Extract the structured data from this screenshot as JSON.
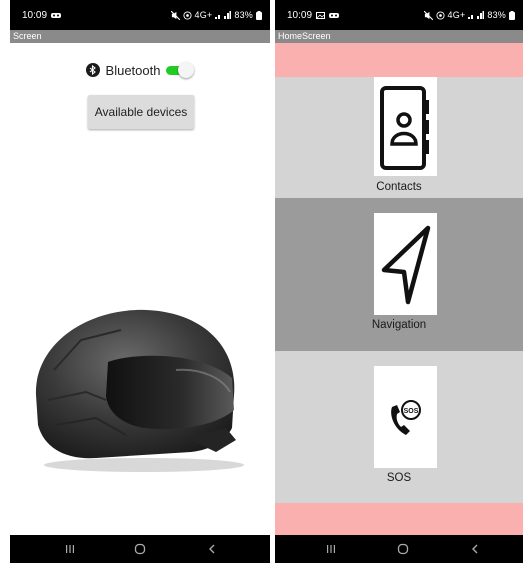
{
  "status_left": {
    "time": "10:09",
    "battery": "83%",
    "network": "4G+"
  },
  "status_right": {
    "time": "10:09",
    "battery": "83%",
    "network": "4G+"
  },
  "screen_left": {
    "title": "Screen",
    "bluetooth_label": "Bluetooth",
    "bluetooth_on": true,
    "available_button": "Available devices"
  },
  "screen_right": {
    "title": "HomeScreen",
    "items": [
      {
        "label": "Contacts",
        "icon": "contacts-icon"
      },
      {
        "label": "Navigation",
        "icon": "navigation-icon"
      },
      {
        "label": "SOS",
        "icon": "sos-phone-icon"
      }
    ]
  },
  "colors": {
    "statusbar": "#000000",
    "titlebar": "#8a8a8a",
    "switch_on": "#22cc22",
    "pink_band": "#fbb0b0",
    "section_light": "#d4d4d4",
    "section_dark": "#9b9b9b"
  }
}
